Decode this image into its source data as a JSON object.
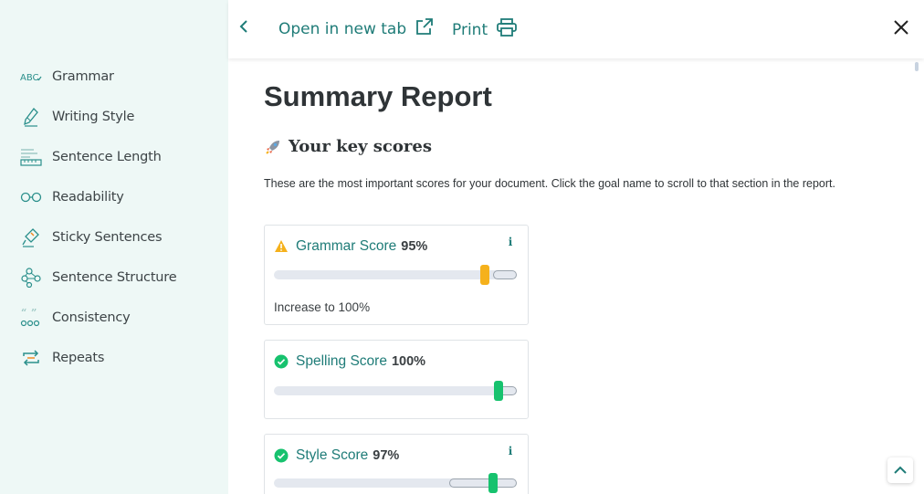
{
  "sidebar": {
    "items": [
      {
        "label": "Grammar",
        "icon": "abc-icon"
      },
      {
        "label": "Writing Style",
        "icon": "pen-icon"
      },
      {
        "label": "Sentence Length",
        "icon": "ruler-icon"
      },
      {
        "label": "Readability",
        "icon": "glasses-icon"
      },
      {
        "label": "Sticky Sentences",
        "icon": "glue-icon"
      },
      {
        "label": "Sentence Structure",
        "icon": "structure-icon"
      },
      {
        "label": "Consistency",
        "icon": "quote-dots-icon"
      },
      {
        "label": "Repeats",
        "icon": "repeat-icon"
      }
    ]
  },
  "header": {
    "open_tab_label": "Open in new tab",
    "print_label": "Print"
  },
  "main": {
    "title": "Summary Report",
    "section_heading": "Your key scores",
    "description": "These are the most important scores for your document. Click the goal name to scroll to that section in the report.",
    "scores": [
      {
        "name": "Grammar Score",
        "value": "95%",
        "status": "warning",
        "note": "Increase to 100%",
        "level": 0.95
      },
      {
        "name": "Spelling Score",
        "value": "100%",
        "status": "ok",
        "level": 1.0
      },
      {
        "name": "Style Score",
        "value": "97%",
        "status": "ok",
        "level": 0.97
      }
    ]
  },
  "colors": {
    "accent": "#1f7c78",
    "sidebar_bg": "#eef8f6",
    "warning": "#f5b11c",
    "success": "#17c26e"
  }
}
